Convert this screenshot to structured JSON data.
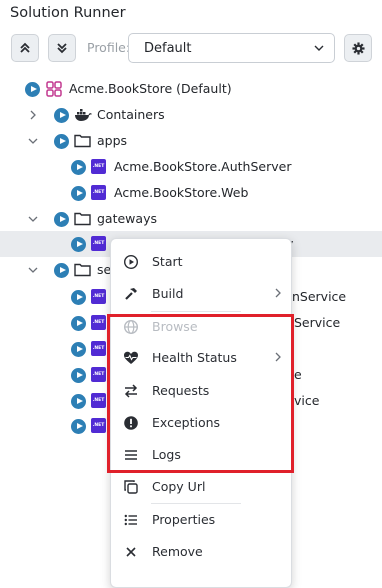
{
  "panel": {
    "title": "Solution Runner"
  },
  "toolbar": {
    "collapse_all_icon": "collapse-all-icon",
    "expand_all_icon": "expand-all-icon",
    "profile_label": "Profile:",
    "profile_value": "Default",
    "settings_icon": "gear-icon"
  },
  "tree": {
    "root": "Acme.BookStore (Default)",
    "containers": "Containers",
    "apps": "apps",
    "auth_server": "Acme.BookStore.AuthServer",
    "web": "Acme.BookStore.Web",
    "gateways": "gateways",
    "gateway_tail": "y",
    "services_partial": "se",
    "svc1_tail": "nService",
    "svc2_tail": "Service",
    "svc4_tail": "e",
    "svc5_tail": "vice"
  },
  "context_menu": {
    "start": "Start",
    "build": "Build",
    "browse": "Browse",
    "health_status": "Health Status",
    "requests": "Requests",
    "exceptions": "Exceptions",
    "logs": "Logs",
    "copy_url": "Copy Url",
    "properties": "Properties",
    "remove": "Remove"
  },
  "colors": {
    "highlight": "#e0202a",
    "play": "#2d7fb5",
    "dotnet": "#512bd4",
    "solution_icon": "#c2388f"
  }
}
